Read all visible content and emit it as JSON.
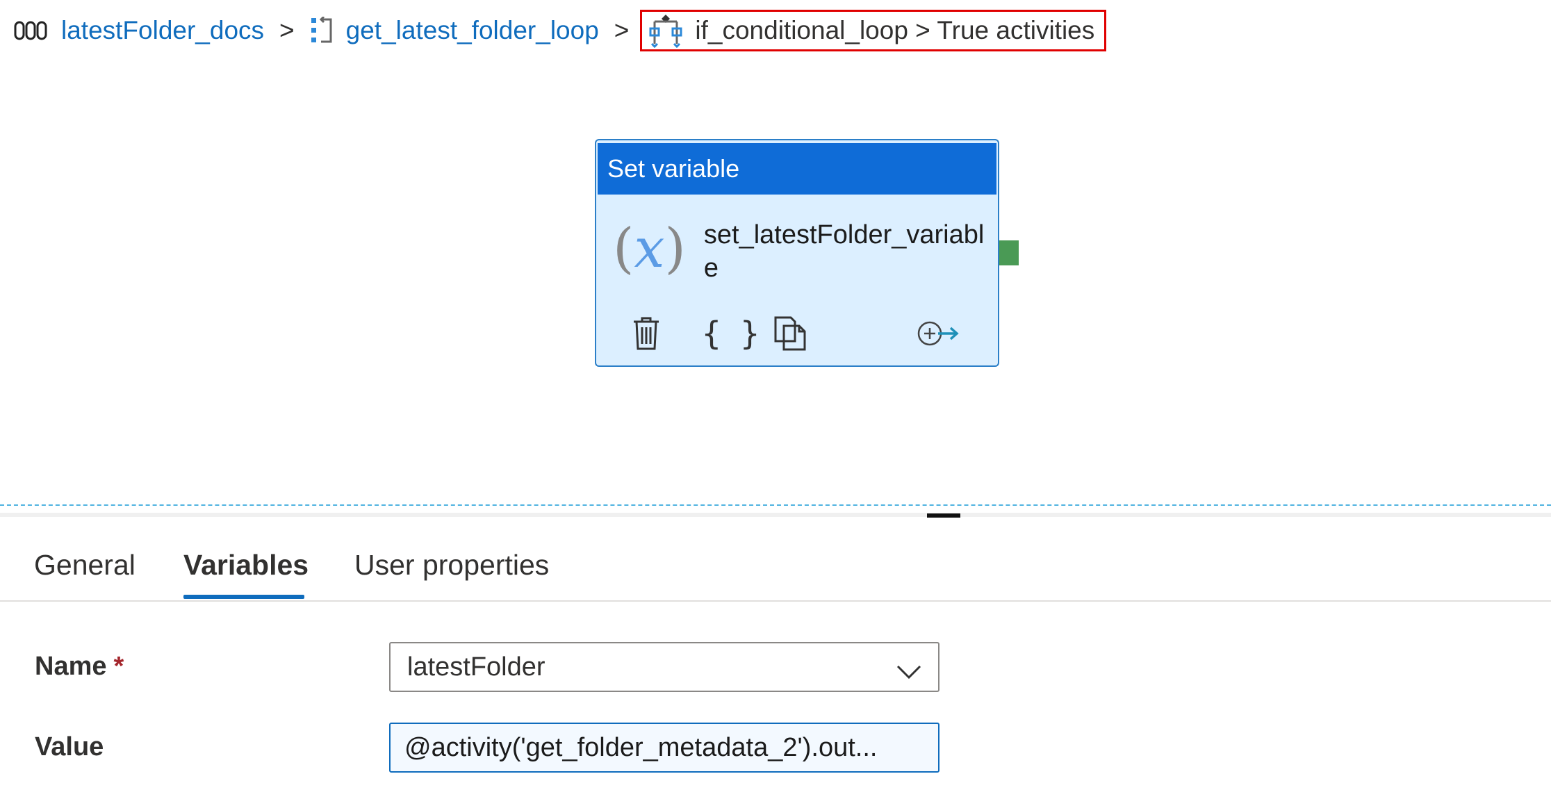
{
  "breadcrumb": {
    "pipeline": "latestFolder_docs",
    "foreach": "get_latest_folder_loop",
    "separator": ">",
    "current": "if_conditional_loop > True activities"
  },
  "activity": {
    "type_label": "Set variable",
    "name": "set_latestFolder_variable",
    "icon_glyph": "(𝑥)"
  },
  "tabs": [
    {
      "label": "General"
    },
    {
      "label": "Variables"
    },
    {
      "label": "User properties"
    }
  ],
  "active_tab": "Variables",
  "form": {
    "name_label": "Name",
    "required_mark": "*",
    "name_value": "latestFolder",
    "value_label": "Value",
    "value_text": "@activity('get_folder_metadata_2').out..."
  },
  "colors": {
    "accent": "#0f6cbd",
    "card_header": "#0f6cd7",
    "card_body": "#dcefff",
    "success_handle": "#4a9a55",
    "highlight_box": "#e00000"
  }
}
